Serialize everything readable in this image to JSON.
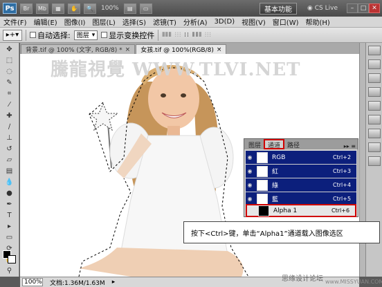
{
  "titlebar": {
    "logo": "Ps",
    "buttons": [
      "Br",
      "Mb"
    ],
    "zoom": "100%",
    "workspace": "基本功能",
    "cs_live": "CS Live"
  },
  "menu": [
    "文件(F)",
    "编辑(E)",
    "图像(I)",
    "图层(L)",
    "选择(S)",
    "滤镜(T)",
    "分析(A)",
    "3D(D)",
    "视图(V)",
    "窗口(W)",
    "帮助(H)"
  ],
  "options": {
    "auto_select": "自动选择:",
    "layer_select": "图层",
    "show_transform": "显示变换控件"
  },
  "tabs": [
    {
      "label": "背景.tif @ 100% (文字, RGB/8) *"
    },
    {
      "label": "女孩.tif @ 100%(RGB/8)"
    }
  ],
  "watermark": "騰龍視覺 WWW.TLVI.NET",
  "channels_panel": {
    "tabs": [
      "图层",
      "通道",
      "路径"
    ],
    "rows": [
      {
        "name": "RGB",
        "shortcut": "Ctrl+2"
      },
      {
        "name": "紅",
        "shortcut": "Ctrl+3"
      },
      {
        "name": "綠",
        "shortcut": "Ctrl+4"
      },
      {
        "name": "藍",
        "shortcut": "Ctrl+5"
      },
      {
        "name": "Alpha 1",
        "shortcut": "Ctrl+6"
      }
    ]
  },
  "callout": "按下<Ctrl>键，单击“Alpha1”通道载入图像选区",
  "status": {
    "zoom": "100%",
    "doc": "文档:1.36M/1.63M"
  },
  "footer": {
    "site_cn": "思缘设计论坛",
    "site_en": "www.MISSYUAN.COM"
  }
}
